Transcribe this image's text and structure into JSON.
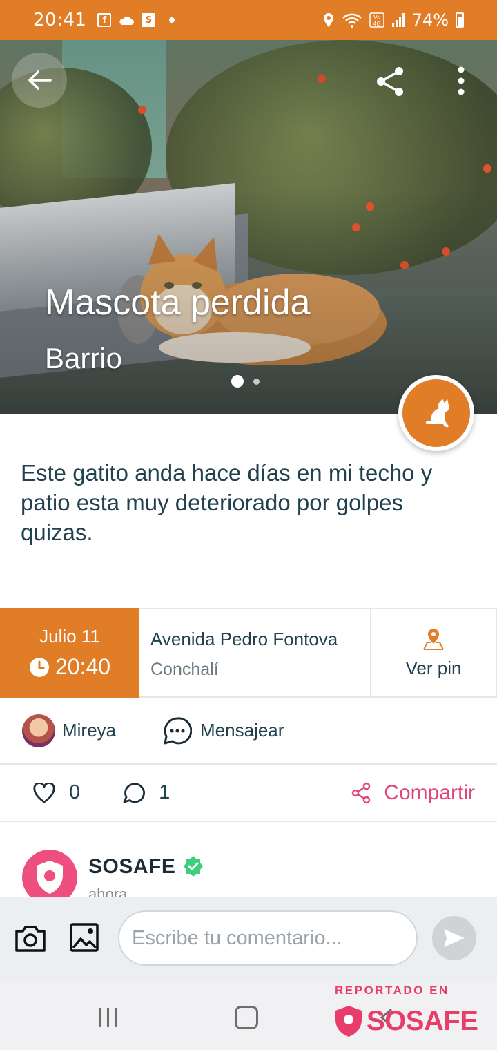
{
  "status_bar": {
    "time": "20:41",
    "battery": "74%",
    "left_icons": [
      "facebook-icon",
      "cloud-icon",
      "s-app-icon",
      "dot"
    ],
    "right_icons": [
      "location-icon",
      "wifi-icon",
      "volte-icon",
      "signal-icon",
      "battery-icon"
    ]
  },
  "hero": {
    "title": "Mascota perdida",
    "subtitle": "Barrio",
    "carousel": {
      "pages": 2,
      "active": 1
    }
  },
  "description": "Este gatito anda hace días en mi techo y patio esta muy deteriorado por golpes quizas.",
  "info": {
    "date": "Julio 11",
    "time": "20:40",
    "address": "Avenida Pedro Fontova",
    "comuna": "Conchalí",
    "pin_label": "Ver pin"
  },
  "user": {
    "name": "Mireya",
    "message_label": "Mensajear"
  },
  "actions": {
    "likes": "0",
    "comments": "1",
    "share_label": "Compartir"
  },
  "comment": {
    "author": "SOSAFE",
    "time": "ahora"
  },
  "composer": {
    "placeholder": "Escribe tu comentario..."
  },
  "watermark": {
    "top": "REPORTADO EN",
    "brand": "SOSAFE"
  },
  "colors": {
    "accent": "#e07d26",
    "brand_pink": "#e83d6a",
    "text": "#22414f",
    "verified": "#3fcf7a"
  }
}
